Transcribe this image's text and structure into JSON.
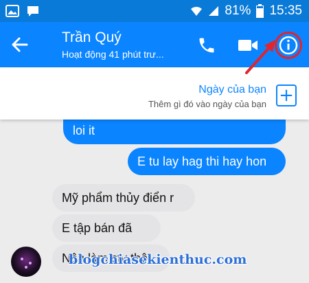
{
  "status_bar": {
    "battery_percent": "81%",
    "time": "15:35",
    "icons": [
      "photo-icon",
      "chat-icon",
      "wifi-icon",
      "signal-icon",
      "battery-icon"
    ]
  },
  "header": {
    "contact_name": "Trần Quý",
    "contact_status": "Hoạt động 41 phút trư...",
    "icons": [
      "back-arrow-icon",
      "phone-icon",
      "video-camera-icon",
      "info-icon"
    ],
    "accent_color": "#0a84ff"
  },
  "day_banner": {
    "title": "Ngày của bạn",
    "subtitle": "Thêm gì đó vào ngày của bạn",
    "add_icon": "plus-icon"
  },
  "messages": [
    {
      "direction": "outgoing",
      "text": "loi it"
    },
    {
      "direction": "outgoing",
      "text": "E tu lay hag thi hay hon"
    },
    {
      "direction": "incoming",
      "text": "Mỹ phẩm thủy điển r"
    },
    {
      "direction": "incoming",
      "text": "E tập bán đã"
    },
    {
      "direction": "incoming",
      "text": "Nên làm ctv thôi"
    }
  ],
  "watermark": "blogchiasekienthuc.com",
  "annotation": {
    "highlight_color": "#e3242b"
  }
}
